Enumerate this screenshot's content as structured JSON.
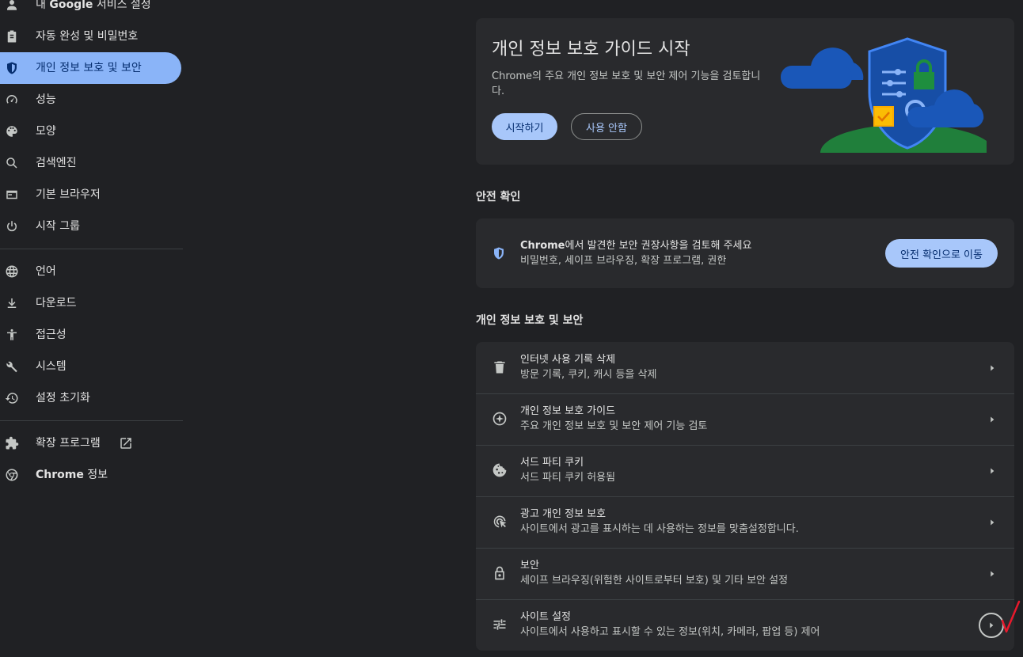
{
  "sidebar": {
    "items": [
      {
        "label": "내 Google 서비스 설정",
        "label_bold": "Google",
        "icon": "person-icon",
        "active": false
      },
      {
        "label": "자동 완성 및 비밀번호",
        "icon": "clipboard-icon",
        "active": false
      },
      {
        "label": "개인 정보 보호 및 보안",
        "icon": "shield-icon",
        "active": true
      },
      {
        "label": "성능",
        "icon": "speedometer-icon",
        "active": false
      },
      {
        "label": "모양",
        "icon": "palette-icon",
        "active": false
      },
      {
        "label": "검색엔진",
        "icon": "search-icon",
        "active": false
      },
      {
        "label": "기본 브라우저",
        "icon": "browser-window-icon",
        "active": false
      },
      {
        "label": "시작 그룹",
        "icon": "power-icon",
        "active": false
      },
      {
        "label": "언어",
        "icon": "globe-icon",
        "active": false
      },
      {
        "label": "다운로드",
        "icon": "download-icon",
        "active": false
      },
      {
        "label": "접근성",
        "icon": "accessibility-icon",
        "active": false
      },
      {
        "label": "시스템",
        "icon": "wrench-icon",
        "active": false
      },
      {
        "label": "설정 초기화",
        "icon": "history-icon",
        "active": false
      },
      {
        "label": "확장 프로그램",
        "icon": "puzzle-icon",
        "active": false
      },
      {
        "label": "Chrome 정보",
        "icon": "chrome-icon",
        "active": false
      }
    ],
    "google_prefix": "내 ",
    "google_bold": "Google",
    "google_suffix": " 서비스 설정",
    "chrome_bold": "Chrome",
    "chrome_suffix": " 정보"
  },
  "guide": {
    "title": "개인 정보 보호 가이드 시작",
    "description": "Chrome의 주요 개인 정보 보호 및 보안 제어 기능을 검토합니다.",
    "start_button": "시작하기",
    "dismiss_button": "사용 안함"
  },
  "safety": {
    "section_title": "안전 확인",
    "title_bold": "Chrome",
    "title_rest": "에서 발견한 보안 권장사항을 검토해 주세요",
    "subtitle": "비밀번호, 세이프 브라우징, 확장 프로그램, 권한",
    "button": "안전 확인으로 이동"
  },
  "privacy": {
    "section_title": "개인 정보 보호 및 보안",
    "rows": [
      {
        "title": "인터넷 사용 기록 삭제",
        "subtitle": "방문 기록, 쿠키, 캐시 등을 삭제",
        "icon": "trash-icon"
      },
      {
        "title": "개인 정보 보호 가이드",
        "subtitle": "주요 개인 정보 보호 및 보안 제어 기능 검토",
        "icon": "compass-icon"
      },
      {
        "title": "서드 파티 쿠키",
        "subtitle": "서드 파티 쿠키 허용됨",
        "icon": "cookie-icon"
      },
      {
        "title": "광고 개인 정보 보호",
        "subtitle": "사이트에서 광고를 표시하는 데 사용하는 정보를 맞춤설정합니다.",
        "icon": "ad-privacy-icon"
      },
      {
        "title": "보안",
        "subtitle": "세이프 브라우징(위험한 사이트로부터 보호) 및 기타 보안 설정",
        "icon": "lock-icon"
      },
      {
        "title": "사이트 설정",
        "subtitle": "사이트에서 사용하고 표시할 수 있는 정보(위치, 카메라, 팝업 등) 제어",
        "icon": "sliders-icon"
      }
    ]
  },
  "colors": {
    "background": "#202124",
    "card": "#292a2d",
    "accent": "#a8c7fa",
    "active_nav": "#8ab4f8",
    "annotation": "#e8192c"
  }
}
